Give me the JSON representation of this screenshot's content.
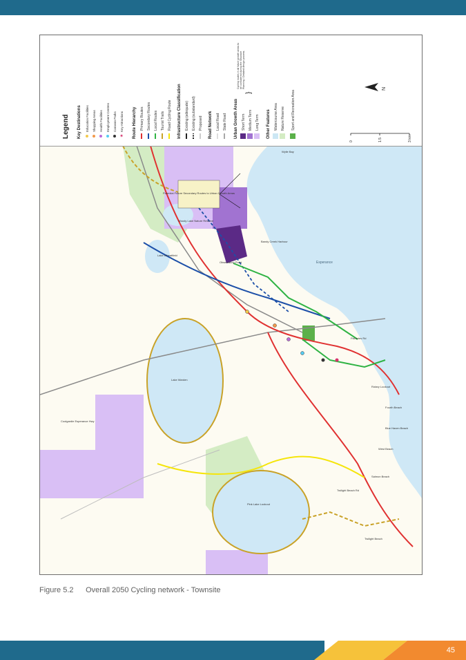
{
  "legend": {
    "title": "Legend",
    "key_destinations": {
      "heading": "Key Destinations",
      "items": [
        {
          "label": "Education Facilities",
          "color": "#f2c94c"
        },
        {
          "label": "Shopping Areas",
          "color": "#f2994a"
        },
        {
          "label": "Health Facilities",
          "color": "#bb6bd9"
        },
        {
          "label": "Employment Centres",
          "color": "#56ccf2"
        },
        {
          "label": "Caravan Parks",
          "color": "#333333"
        },
        {
          "label": "Key Attractions",
          "color": "#d6336c"
        }
      ]
    },
    "route_hierarchy": {
      "heading": "Route Hierarchy",
      "items": [
        {
          "label": "Primary Routes",
          "color": "#e03131"
        },
        {
          "label": "Secondary Routes",
          "color": "#1c4fa8"
        },
        {
          "label": "Local Routes",
          "color": "#2fb344"
        },
        {
          "label": "Tourist Trails",
          "color": "#c9a227"
        },
        {
          "label": "Road Cycling Route",
          "color": "#f5e50a"
        }
      ]
    },
    "infrastructure": {
      "heading": "Infrastructure Classification",
      "items": [
        {
          "label": "Existing (adequate)"
        },
        {
          "label": "Existing (substandard)"
        },
        {
          "label": "Proposed"
        }
      ]
    },
    "road_network": {
      "heading": "Road Network",
      "items": [
        {
          "label": "Local Road",
          "color": "#bdbdbd"
        },
        {
          "label": "State Road",
          "color": "#8a8a8a"
        }
      ]
    },
    "urban_growth": {
      "heading": "Urban Growth Areas",
      "items": [
        {
          "label": "Short Term",
          "color": "#5b2a86"
        },
        {
          "label": "Medium Term",
          "color": "#a173d1"
        },
        {
          "label": "Long Term",
          "color": "#d9bff5"
        }
      ],
      "note": "Cycling routes in all future growth areas to be considered during the Structure Planning / Detailed design process."
    },
    "other_features": {
      "heading": "Other Features",
      "items": [
        {
          "label": "Watercourse Area",
          "color": "#cce7f4"
        },
        {
          "label": "Nature Reserve",
          "color": "#d4ecc4"
        },
        {
          "label": "Sport and Recreation Area",
          "color": "#5bb14a"
        }
      ]
    },
    "north_label": "N",
    "scale": {
      "ticks": [
        "0",
        "1.5",
        "3 km"
      ]
    }
  },
  "map_labels": {
    "callout": "Potential Future Secondary Routes to Urban Growth Areas",
    "esperance": "Esperance",
    "bandy_creek_harbour": "Bandy Creek Harbour",
    "observatory": "Observatory Point",
    "wylie": "Wylie Bay",
    "pink_lake": "Pink Lake Lookout",
    "woody_lake": "Woody Lake Nature Reserve",
    "coolgardie_hwy": "Coolgardie Esperance Hwy",
    "fisheries_rd": "Fisheries Rd",
    "twilight_beach": "Twilight Beach",
    "twilight_beach_rd": "Twilight Beach Rd",
    "west_beach": "West Beach",
    "blue_haven": "Blue Haven Beach",
    "salmon_beach": "Salmon Beach",
    "fourth_beach": "Fourth Beach",
    "rotary_lookout": "Rotary Lookout",
    "lake_warden": "Lake Warden",
    "lake_wheatfield": "Lake Wheatfield"
  },
  "caption": {
    "number": "Figure 5.2",
    "text": "Overall 2050 Cycling network - Townsite"
  },
  "page_number": "45",
  "colors": {
    "top_band": "#1f6a8c",
    "footer_blue": "#1f6a8c",
    "footer_yellow": "#f6c23a",
    "footer_orange": "#f28a2f",
    "ocean": "#cfe8f6",
    "land": "#fdfbf2",
    "reserve": "#d4ecc4"
  }
}
